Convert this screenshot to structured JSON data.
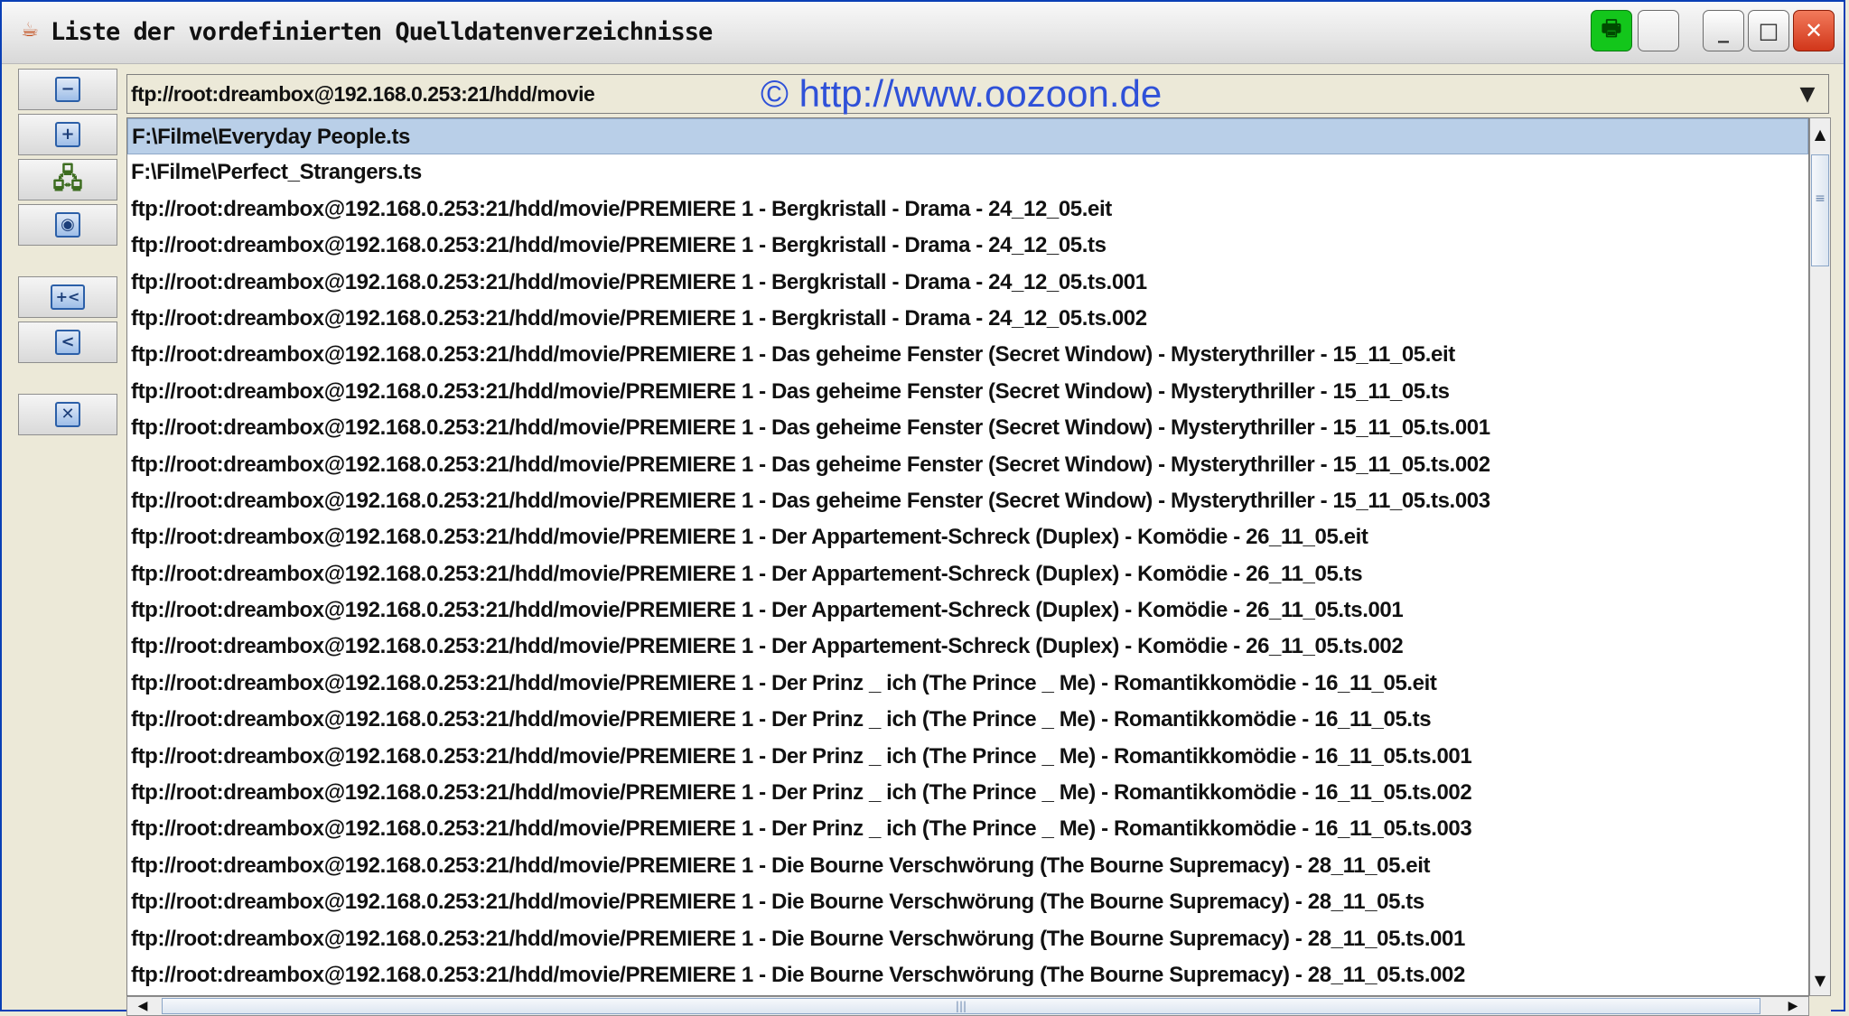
{
  "window": {
    "title": "Liste der vordefinierten Quelldatenverzeichnisse",
    "app_icon": "java-cup-icon",
    "buttons": [
      {
        "name": "print",
        "icon": "printer-icon"
      },
      {
        "name": "blank",
        "icon": ""
      },
      {
        "name": "minimize",
        "icon": "minimize-icon",
        "glyph": "_"
      },
      {
        "name": "maximize",
        "icon": "maximize-icon",
        "glyph": "□"
      },
      {
        "name": "close",
        "icon": "close-icon",
        "glyph": "✕"
      }
    ]
  },
  "toolbar": [
    {
      "icon": "remove-icon",
      "glyph": "−"
    },
    {
      "icon": "add-icon",
      "glyph": "+"
    },
    {
      "icon": "network-drive-icon",
      "glyph": "🖧"
    },
    {
      "icon": "open-folder-icon",
      "glyph": "◉"
    },
    {
      "icon": "add-to-list-icon",
      "glyph": "+<"
    },
    {
      "icon": "move-left-icon",
      "glyph": "<"
    },
    {
      "icon": "clear-icon",
      "glyph": "✕"
    }
  ],
  "combo": {
    "value": "ftp://root:dreambox@192.168.0.253:21/hdd/movie"
  },
  "watermark": "© http://www.oozoon.de",
  "list": {
    "selected_index": 0,
    "items": [
      "F:\\Filme\\Everyday People.ts",
      "F:\\Filme\\Perfect_Strangers.ts",
      "ftp://root:dreambox@192.168.0.253:21/hdd/movie/PREMIERE 1 - Bergkristall - Drama - 24_12_05.eit",
      "ftp://root:dreambox@192.168.0.253:21/hdd/movie/PREMIERE 1 - Bergkristall - Drama - 24_12_05.ts",
      "ftp://root:dreambox@192.168.0.253:21/hdd/movie/PREMIERE 1 - Bergkristall - Drama - 24_12_05.ts.001",
      "ftp://root:dreambox@192.168.0.253:21/hdd/movie/PREMIERE 1 - Bergkristall - Drama - 24_12_05.ts.002",
      "ftp://root:dreambox@192.168.0.253:21/hdd/movie/PREMIERE 1 - Das geheime Fenster (Secret Window) - Mysterythriller - 15_11_05.eit",
      "ftp://root:dreambox@192.168.0.253:21/hdd/movie/PREMIERE 1 - Das geheime Fenster (Secret Window) - Mysterythriller - 15_11_05.ts",
      "ftp://root:dreambox@192.168.0.253:21/hdd/movie/PREMIERE 1 - Das geheime Fenster (Secret Window) - Mysterythriller - 15_11_05.ts.001",
      "ftp://root:dreambox@192.168.0.253:21/hdd/movie/PREMIERE 1 - Das geheime Fenster (Secret Window) - Mysterythriller - 15_11_05.ts.002",
      "ftp://root:dreambox@192.168.0.253:21/hdd/movie/PREMIERE 1 - Das geheime Fenster (Secret Window) - Mysterythriller - 15_11_05.ts.003",
      "ftp://root:dreambox@192.168.0.253:21/hdd/movie/PREMIERE 1 - Der Appartement-Schreck (Duplex) - Komödie - 26_11_05.eit",
      "ftp://root:dreambox@192.168.0.253:21/hdd/movie/PREMIERE 1 - Der Appartement-Schreck (Duplex) - Komödie - 26_11_05.ts",
      "ftp://root:dreambox@192.168.0.253:21/hdd/movie/PREMIERE 1 - Der Appartement-Schreck (Duplex) - Komödie - 26_11_05.ts.001",
      "ftp://root:dreambox@192.168.0.253:21/hdd/movie/PREMIERE 1 - Der Appartement-Schreck (Duplex) - Komödie - 26_11_05.ts.002",
      "ftp://root:dreambox@192.168.0.253:21/hdd/movie/PREMIERE 1 - Der Prinz _ ich (The Prince _ Me) - Romantikkomödie - 16_11_05.eit",
      "ftp://root:dreambox@192.168.0.253:21/hdd/movie/PREMIERE 1 - Der Prinz _ ich (The Prince _ Me) - Romantikkomödie - 16_11_05.ts",
      "ftp://root:dreambox@192.168.0.253:21/hdd/movie/PREMIERE 1 - Der Prinz _ ich (The Prince _ Me) - Romantikkomödie - 16_11_05.ts.001",
      "ftp://root:dreambox@192.168.0.253:21/hdd/movie/PREMIERE 1 - Der Prinz _ ich (The Prince _ Me) - Romantikkomödie - 16_11_05.ts.002",
      "ftp://root:dreambox@192.168.0.253:21/hdd/movie/PREMIERE 1 - Der Prinz _ ich (The Prince _ Me) - Romantikkomödie - 16_11_05.ts.003",
      "ftp://root:dreambox@192.168.0.253:21/hdd/movie/PREMIERE 1 - Die Bourne Verschwörung (The Bourne Supremacy) - 28_11_05.eit",
      "ftp://root:dreambox@192.168.0.253:21/hdd/movie/PREMIERE 1 - Die Bourne Verschwörung (The Bourne Supremacy) - 28_11_05.ts",
      "ftp://root:dreambox@192.168.0.253:21/hdd/movie/PREMIERE 1 - Die Bourne Verschwörung (The Bourne Supremacy) - 28_11_05.ts.001",
      "ftp://root:dreambox@192.168.0.253:21/hdd/movie/PREMIERE 1 - Die Bourne Verschwörung (The Bourne Supremacy) - 28_11_05.ts.002"
    ]
  },
  "scrollbars": {
    "vertical": {
      "up": "▲",
      "down": "▼",
      "grip": "≡"
    },
    "horizontal": {
      "left": "◀",
      "right": "▶",
      "grip": "|||"
    }
  }
}
